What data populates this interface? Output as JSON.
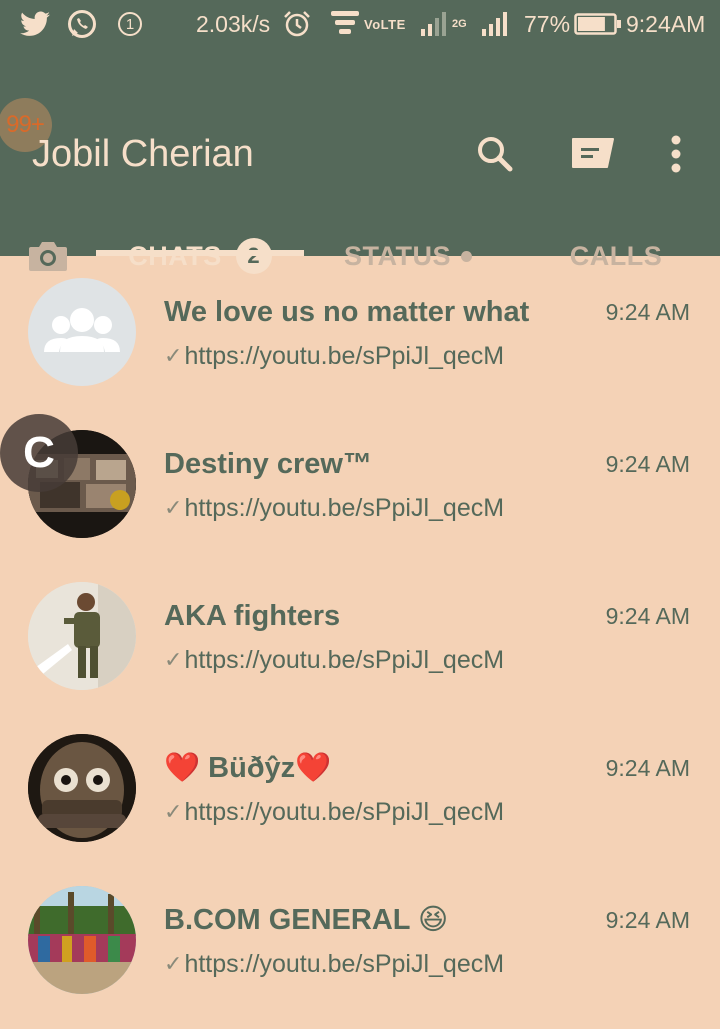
{
  "status_bar": {
    "notification_count": "1",
    "net_speed": "2.03k/s",
    "volte": "VoLTE",
    "network_type": "2G",
    "battery_percent": "77%",
    "battery_level": 0.77,
    "time": "9:24AM"
  },
  "header": {
    "unread_badge": "99+",
    "title": "Jobil Cherian"
  },
  "tabs": {
    "chats_label": "CHATS",
    "chats_badge": "2",
    "status_label": "STATUS",
    "calls_label": "CALLS"
  },
  "camera_fab_label": "C",
  "chats": [
    {
      "name": "We love us no matter what",
      "time": "9:24 AM",
      "preview": "https://youtu.be/sPpiJl_qecM",
      "avatar": "group-placeholder-icon"
    },
    {
      "name": "Destiny crew™",
      "time": "9:24 AM",
      "preview": "https://youtu.be/sPpiJl_qecM",
      "avatar": "photo"
    },
    {
      "name": "AKA fighters",
      "time": "9:24 AM",
      "preview": "https://youtu.be/sPpiJl_qecM",
      "avatar": "photo"
    },
    {
      "name": "❤️ Büðŷz❤️",
      "time": "9:24 AM",
      "preview": "https://youtu.be/sPpiJl_qecM",
      "avatar": "photo"
    },
    {
      "name": "B.COM GENERAL 😆",
      "time": "9:24 AM",
      "preview": "https://youtu.be/sPpiJl_qecM",
      "avatar": "photo"
    }
  ],
  "colors": {
    "header_bg": "#55695a",
    "list_bg": "#f4d2b6",
    "accent": "#f6dfc9",
    "text": "#55695a"
  }
}
